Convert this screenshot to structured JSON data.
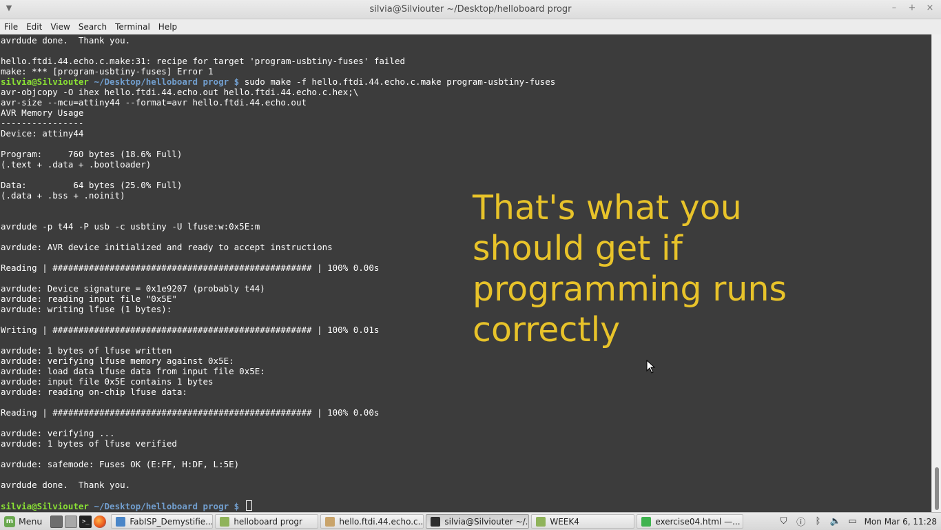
{
  "window": {
    "title": "silvia@Silviouter ~/Desktop/helloboard progr",
    "controls": {
      "minimize": "–",
      "maximize": "+",
      "close": "×"
    }
  },
  "menubar": [
    "File",
    "Edit",
    "View",
    "Search",
    "Terminal",
    "Help"
  ],
  "terminal": {
    "lines": [
      "avrdude done.  Thank you.",
      "",
      "hello.ftdi.44.echo.c.make:31: recipe for target 'program-usbtiny-fuses' failed",
      "make: *** [program-usbtiny-fuses] Error 1",
      "__PROMPT1__",
      "avr-objcopy -O ihex hello.ftdi.44.echo.out hello.ftdi.44.echo.c.hex;\\",
      "avr-size --mcu=attiny44 --format=avr hello.ftdi.44.echo.out",
      "AVR Memory Usage",
      "----------------",
      "Device: attiny44",
      "",
      "Program:     760 bytes (18.6% Full)",
      "(.text + .data + .bootloader)",
      "",
      "Data:         64 bytes (25.0% Full)",
      "(.data + .bss + .noinit)",
      "",
      "",
      "avrdude -p t44 -P usb -c usbtiny -U lfuse:w:0x5E:m",
      "",
      "avrdude: AVR device initialized and ready to accept instructions",
      "",
      "Reading | ################################################## | 100% 0.00s",
      "",
      "avrdude: Device signature = 0x1e9207 (probably t44)",
      "avrdude: reading input file \"0x5E\"",
      "avrdude: writing lfuse (1 bytes):",
      "",
      "Writing | ################################################## | 100% 0.01s",
      "",
      "avrdude: 1 bytes of lfuse written",
      "avrdude: verifying lfuse memory against 0x5E:",
      "avrdude: load data lfuse data from input file 0x5E:",
      "avrdude: input file 0x5E contains 1 bytes",
      "avrdude: reading on-chip lfuse data:",
      "",
      "Reading | ################################################## | 100% 0.00s",
      "",
      "avrdude: verifying ...",
      "avrdude: 1 bytes of lfuse verified",
      "",
      "avrdude: safemode: Fuses OK (E:FF, H:DF, L:5E)",
      "",
      "avrdude done.  Thank you.",
      "",
      "__PROMPT2__"
    ],
    "prompt_user": "silvia@Silviouter",
    "prompt_path": " ~/Desktop/helloboard progr $",
    "prompt1_command": " sudo make -f hello.ftdi.44.echo.c.make program-usbtiny-fuses",
    "prompt2_command": " "
  },
  "annotation": "That's what you should get if programming runs correctly",
  "taskbar": {
    "menu_label": "Menu",
    "tasks": [
      {
        "label": "FabISP_Demystifie...",
        "icon": "chromium-icon",
        "color": "#4a86c8",
        "active": false
      },
      {
        "label": "helloboard progr",
        "icon": "folder-icon",
        "color": "#8fb35a",
        "active": false
      },
      {
        "label": "hello.ftdi.44.echo.c...",
        "icon": "text-editor-icon",
        "color": "#c9a46b",
        "active": false
      },
      {
        "label": "silvia@Silviouter ~/...",
        "icon": "terminal-icon",
        "color": "#2e2e2e",
        "active": true
      },
      {
        "label": "WEEK4",
        "icon": "folder-icon",
        "color": "#8fb35a",
        "active": false
      },
      {
        "label": "exercise04.html —...",
        "icon": "brackets-icon",
        "color": "#3fb34f",
        "active": false
      }
    ],
    "clock": "Mon Mar  6, 11:28"
  }
}
